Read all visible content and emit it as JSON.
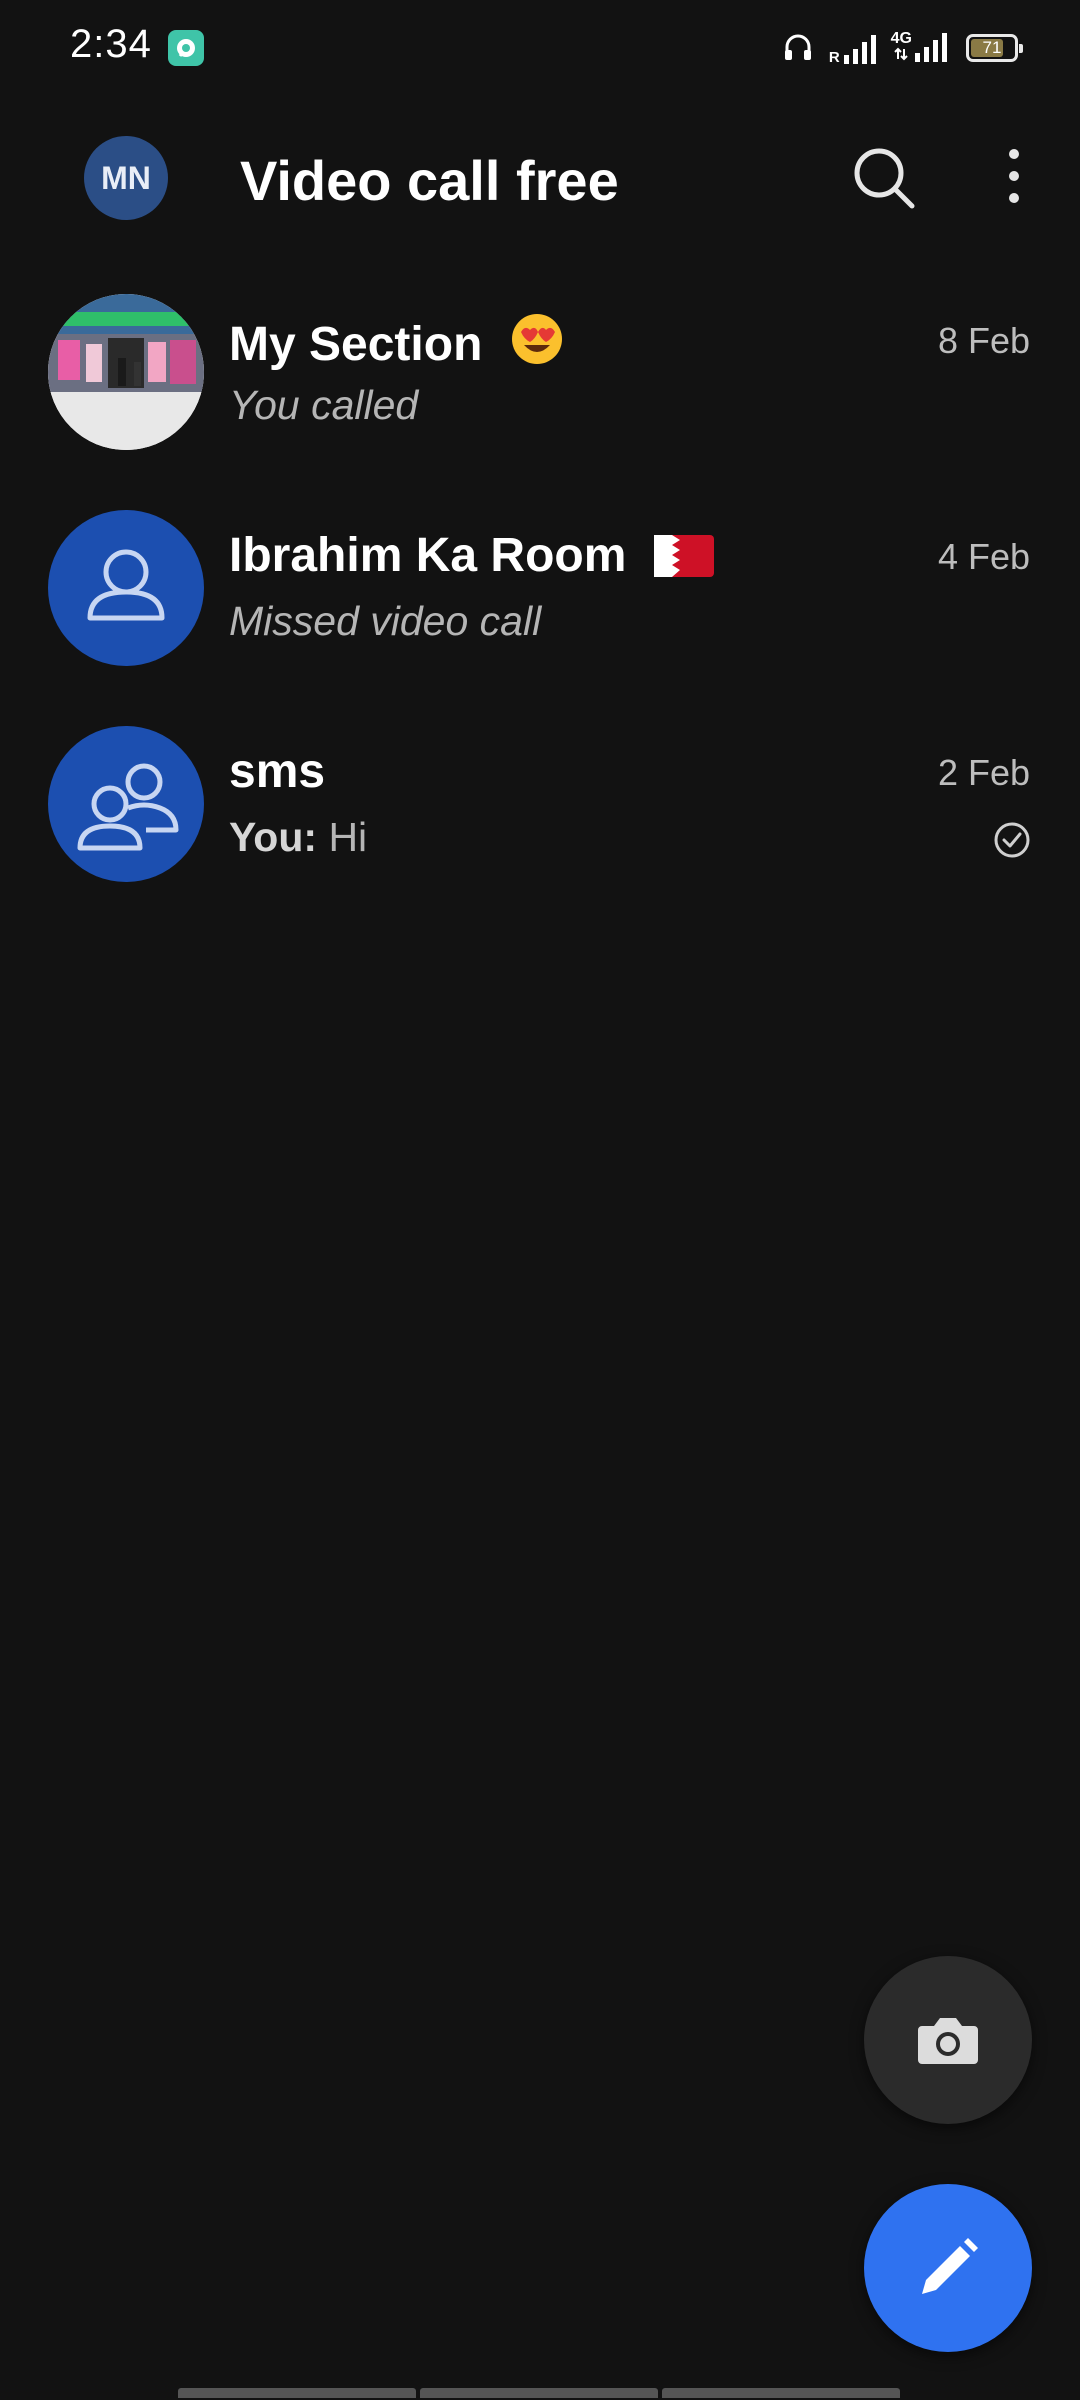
{
  "status_bar": {
    "time": "2:34",
    "network_label": "4G",
    "roaming_label": "R",
    "battery_level": "71"
  },
  "app_bar": {
    "profile_initials": "MN",
    "title": "Video call free"
  },
  "chats": [
    {
      "name": "My Section",
      "emoji": "heart-eyes-emoji",
      "preview": "You called",
      "date": "8 Feb",
      "avatar": "store-photo"
    },
    {
      "name": "Ibrahim Ka Room",
      "emoji": "bahrain-flag-emoji",
      "preview": "Missed video call",
      "date": "4 Feb",
      "avatar": "person-icon"
    },
    {
      "name": "sms",
      "preview_sender": "You:",
      "preview": "Hi",
      "date": "2 Feb",
      "avatar": "group-icon",
      "status_icon": "read-check-icon"
    }
  ],
  "colors": {
    "background": "#121212",
    "avatar_blue": "#1c4fb0",
    "profile_avatar": "#2b4e86",
    "compose_fab": "#2f72f0",
    "camera_fab": "#2b2b2b"
  }
}
